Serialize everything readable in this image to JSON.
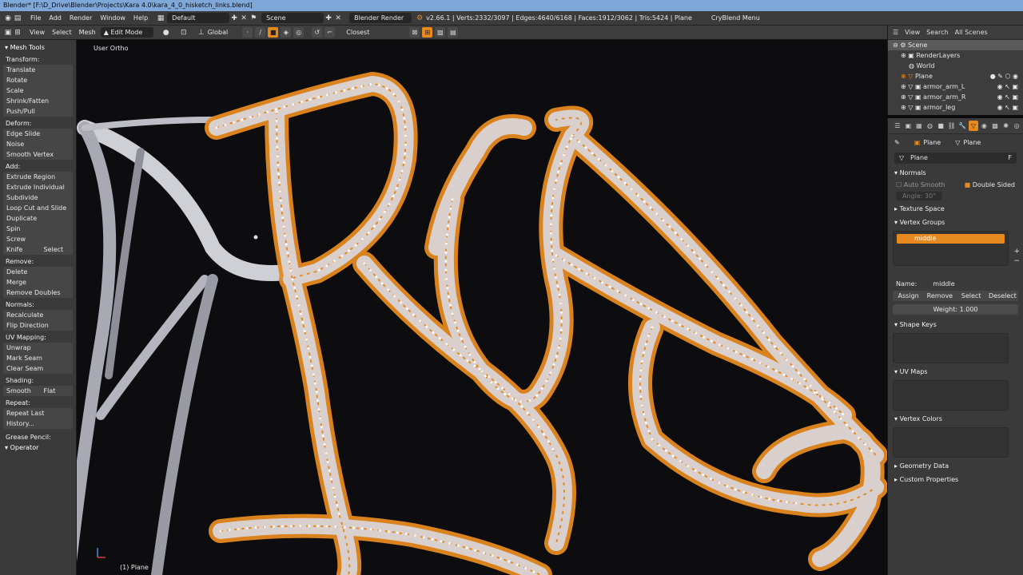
{
  "window": {
    "title": "Blender* [F:\\D_Drive\\Blender\\Projects\\Kara 4.0\\kara_4_0_hisketch_links.blend]"
  },
  "infobar": {
    "menus": [
      "File",
      "Add",
      "Render",
      "Window",
      "Help"
    ],
    "layout": "Default",
    "scene": "Scene",
    "engine": "Blender Render",
    "stats": "v2.66.1 | Verts:2332/3097 | Edges:4640/6168 | Faces:1912/3062 | Tris:5424 | Plane",
    "extra_menu": "CryBlend Menu"
  },
  "toolbar": {
    "items": [
      "View",
      "Select",
      "Mesh"
    ],
    "mode": "Edit Mode",
    "orientation": "Global",
    "snap": "Closest"
  },
  "tools": {
    "header": "Mesh Tools",
    "sections": [
      {
        "label": "Transform:",
        "buttons": [
          "Translate",
          "Rotate",
          "Scale",
          "Shrink/Fatten",
          "Push/Pull"
        ]
      },
      {
        "label": "Deform:",
        "buttons": [
          "Edge Slide",
          "Noise",
          "Smooth Vertex"
        ]
      },
      {
        "label": "Add:",
        "buttons": [
          "Extrude Region",
          "Extrude Individual",
          "Subdivide",
          "Loop Cut and Slide",
          "Duplicate",
          "Spin",
          "Screw"
        ]
      },
      {
        "label": "Remove:",
        "buttons": [
          "Delete",
          "Merge",
          "Remove Doubles"
        ]
      },
      {
        "label": "Normals:",
        "buttons": [
          "Recalculate",
          "Flip Direction"
        ]
      },
      {
        "label": "UV Mapping:",
        "buttons": [
          "Unwrap",
          "Mark Seam",
          "Clear Seam"
        ]
      }
    ],
    "knife": "Knife",
    "select": "Select",
    "shading_label": "Shading:",
    "smooth": "Smooth",
    "flat": "Flat",
    "repeat_label": "Repeat:",
    "repeat_last": "Repeat Last",
    "history": "History...",
    "grease_pencil": "Grease Pencil:",
    "operator": "Operator"
  },
  "viewport": {
    "label": "User Ortho",
    "object": "(1) Plane"
  },
  "outliner": {
    "menus": [
      "View",
      "Search",
      "All Scenes"
    ],
    "rows": [
      "Scene",
      "RenderLayers",
      "World",
      "Plane",
      "armor_arm_L",
      "armor_arm_R",
      "armor_leg"
    ]
  },
  "properties": {
    "crumb_object": "Plane",
    "crumb_mesh": "Plane",
    "mesh_name": "Plane",
    "mesh_f": "F",
    "normals": "Normals",
    "auto_smooth": "Auto Smooth",
    "double_sided": "Double Sided",
    "angle": "Angle: 30°",
    "texture_space": "Texture Space",
    "vertex_groups": "Vertex Groups",
    "vg_item": "middle",
    "name_label": "Name:",
    "name_value": "middle",
    "assign": "Assign",
    "remove": "Remove",
    "select": "Select",
    "deselect": "Deselect",
    "weight": "Weight: 1.000",
    "shape_keys": "Shape Keys",
    "uv_maps": "UV Maps",
    "vertex_colors": "Vertex Colors",
    "geometry_data": "Geometry Data",
    "custom_properties": "Custom Properties"
  },
  "colors": {
    "accent": "#e68a1f",
    "panel": "#3a3a3a",
    "viewport": "#0d0d0f",
    "titlebar": "#7fa8d8"
  }
}
